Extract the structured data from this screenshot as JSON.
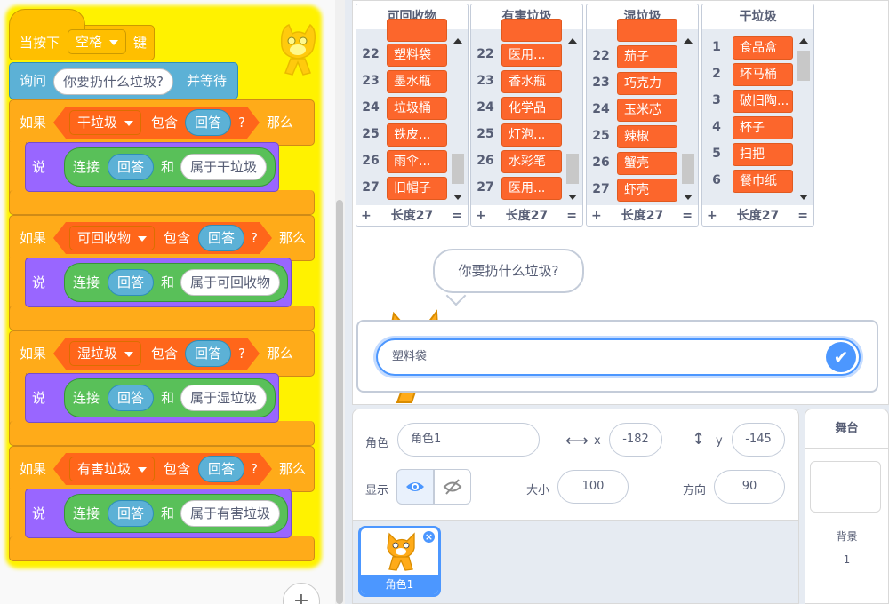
{
  "script": {
    "hat": {
      "prefix": "当按下",
      "key": "空格",
      "suffix": "键"
    },
    "ask": {
      "prefix": "询问",
      "question": "你要扔什么垃圾?",
      "suffix": "并等待"
    },
    "if_blocks": [
      {
        "if_label": "如果",
        "list": "干垃圾",
        "contains": "包含",
        "answer": "回答",
        "q": "?",
        "then": "那么",
        "say": "说",
        "join": "连接",
        "answer2": "回答",
        "and": "和",
        "text": "属于干垃圾"
      },
      {
        "if_label": "如果",
        "list": "可回收物",
        "contains": "包含",
        "answer": "回答",
        "q": "?",
        "then": "那么",
        "say": "说",
        "join": "连接",
        "answer2": "回答",
        "and": "和",
        "text": "属于可回收物"
      },
      {
        "if_label": "如果",
        "list": "湿垃圾",
        "contains": "包含",
        "answer": "回答",
        "q": "?",
        "then": "那么",
        "say": "说",
        "join": "连接",
        "answer2": "回答",
        "and": "和",
        "text": "属于湿垃圾"
      },
      {
        "if_label": "如果",
        "list": "有害垃圾",
        "contains": "包含",
        "answer": "回答",
        "q": "?",
        "then": "那么",
        "say": "说",
        "join": "连接",
        "answer2": "回答",
        "and": "和",
        "text": "属于有害垃圾"
      }
    ],
    "zoom_icon": "+"
  },
  "lists": [
    {
      "title": "可回收物",
      "rows": [
        {
          "i": "22",
          "v": "塑料袋"
        },
        {
          "i": "23",
          "v": "墨水瓶"
        },
        {
          "i": "24",
          "v": "垃圾桶"
        },
        {
          "i": "25",
          "v": "铁皮..."
        },
        {
          "i": "26",
          "v": "雨伞..."
        },
        {
          "i": "27",
          "v": "旧帽子"
        }
      ],
      "length": "长度27"
    },
    {
      "title": "有害垃圾",
      "rows": [
        {
          "i": "22",
          "v": "医用..."
        },
        {
          "i": "23",
          "v": "香水瓶"
        },
        {
          "i": "24",
          "v": "化学品"
        },
        {
          "i": "25",
          "v": "灯泡..."
        },
        {
          "i": "26",
          "v": "水彩笔"
        },
        {
          "i": "27",
          "v": "医用..."
        }
      ],
      "length": "长度27"
    },
    {
      "title": "湿垃圾",
      "rows": [
        {
          "i": "22",
          "v": "茄子"
        },
        {
          "i": "23",
          "v": "巧克力"
        },
        {
          "i": "24",
          "v": "玉米芯"
        },
        {
          "i": "25",
          "v": "辣椒"
        },
        {
          "i": "26",
          "v": "蟹壳"
        },
        {
          "i": "27",
          "v": "虾壳"
        }
      ],
      "length": "长度27"
    },
    {
      "title": "干垃圾",
      "rows": [
        {
          "i": "1",
          "v": "食品盒"
        },
        {
          "i": "2",
          "v": "坏马桶"
        },
        {
          "i": "3",
          "v": "破旧陶..."
        },
        {
          "i": "4",
          "v": "杯子"
        },
        {
          "i": "5",
          "v": "扫把"
        },
        {
          "i": "6",
          "v": "餐巾纸"
        }
      ],
      "length": "长度27"
    }
  ],
  "list_plus": "+",
  "list_eq": "=",
  "stage": {
    "bubble": "你要扔什么垃圾?",
    "answer_value": "塑料袋"
  },
  "sprite_info": {
    "sprite_label": "角色",
    "sprite_name": "角色1",
    "x_label": "x",
    "x": "-182",
    "y_label": "y",
    "y": "-145",
    "show_label": "显示",
    "size_label": "大小",
    "size": "100",
    "direction_label": "方向",
    "direction": "90"
  },
  "sprite_tile": {
    "name": "角色1"
  },
  "stage_pane": {
    "title": "舞台",
    "backdrops_label": "背景",
    "backdrops_count": "1"
  }
}
